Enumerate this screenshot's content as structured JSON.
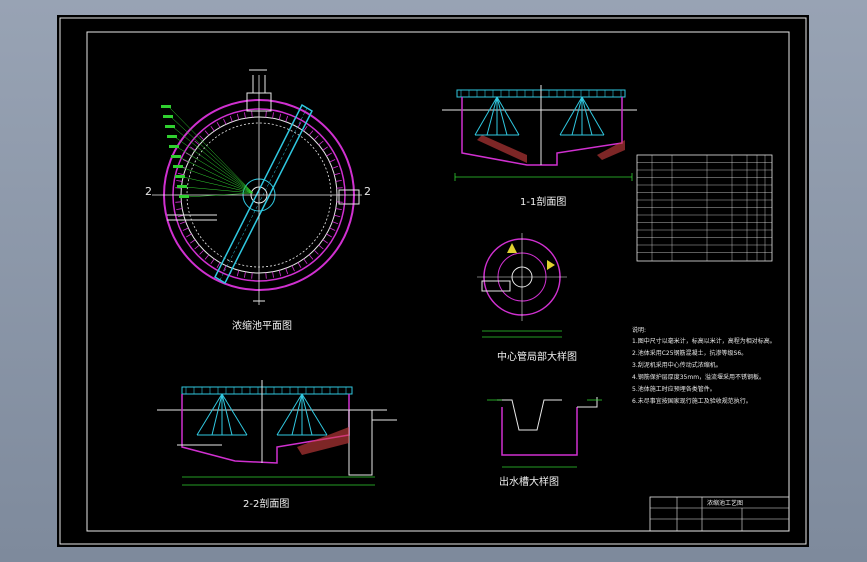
{
  "titles": {
    "plan": "浓缩池平面图",
    "section_1_1": "1-1剖面图",
    "center_pipe_detail": "中心管局部大样图",
    "section_2_2": "2-2剖面图",
    "outlet_trough_detail": "出水槽大样图"
  },
  "section_marks": {
    "left": "2",
    "right": "2"
  },
  "notes": {
    "heading": "说明:",
    "lines": [
      "1.图中尺寸以毫米计，标高以米计，高程为相对标高。",
      "2.池体采用C25钢筋混凝土，抗渗等级S6。",
      "3.刮泥机采用中心传动式浓缩机。",
      "4.钢筋保护层厚度35mm，溢流堰采用不锈钢板。",
      "5.池体施工时应预埋各类管件。",
      "6.未尽事宜按国家现行施工及验收规范执行。"
    ]
  },
  "title_block": {
    "drawing_name": "浓缩池工艺图"
  },
  "colors": {
    "background": "#000000",
    "wall_magenta": "#d030d0",
    "dimension_green": "#30d030",
    "equipment_cyan": "#30c8e0",
    "structure_white": "#e8e8e8",
    "fill_red": "#d04040",
    "accent_yellow": "#e0d030"
  }
}
